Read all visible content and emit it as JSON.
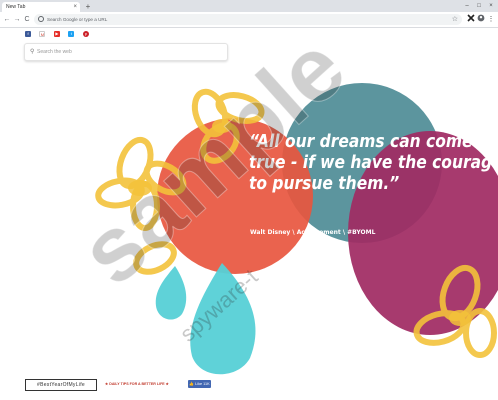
{
  "browser": {
    "tab_title": "New Tab",
    "tab_close": "×",
    "new_tab": "+",
    "window_controls": {
      "minimize": "–",
      "maximize": "□",
      "close": "×"
    },
    "nav": {
      "back": "←",
      "forward": "→",
      "reload": "C"
    },
    "omnibox_placeholder": "Search Google or type a URL",
    "star": "☆",
    "menu": "⋮"
  },
  "social": [
    {
      "name": "facebook",
      "glyph": "f",
      "color": "#3b5998"
    },
    {
      "name": "gmail",
      "glyph": "M",
      "color": "#ffffff"
    },
    {
      "name": "youtube",
      "glyph": "▶",
      "color": "#e52d27"
    },
    {
      "name": "twitter",
      "glyph": "t",
      "color": "#1da1f2"
    },
    {
      "name": "pinterest",
      "glyph": "p",
      "color": "#cb2027"
    }
  ],
  "search": {
    "placeholder": "Search the web"
  },
  "quote": {
    "line1": "“All our dreams can come",
    "line2": "true - if we have the courage",
    "line3": "to pursue them.”",
    "attribution": "Walt Disney \\ Achievement \\ #BYOML"
  },
  "watermark": {
    "big": "sample",
    "small": "spyware-t"
  },
  "footer": {
    "logo": "#BestYearOfMyLife",
    "tagline": "★ DAILY TIPS FOR A BETTER LIFE ★",
    "fb_like": "👍 Like 11K"
  },
  "colors": {
    "accent_red": "#e8563f",
    "accent_teal": "#4a8a93",
    "accent_magenta": "#a02b63",
    "accent_yellow": "#f3c23a",
    "accent_cyan": "#56d0d6"
  }
}
